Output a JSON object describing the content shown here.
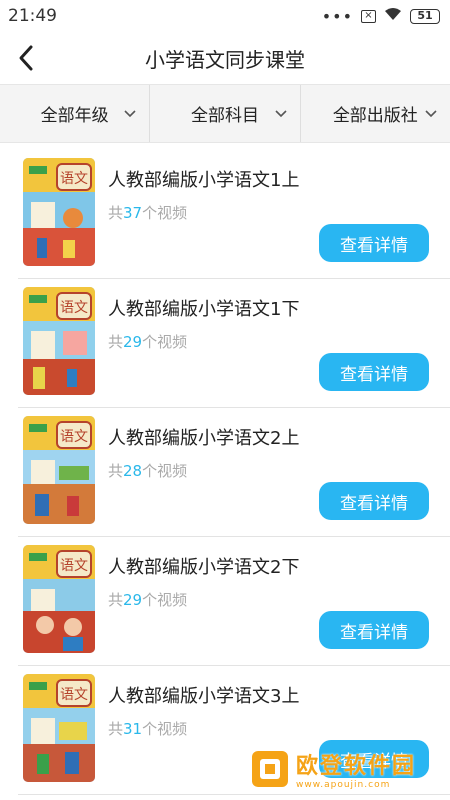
{
  "status_bar": {
    "time": "21:49",
    "dots": "•••",
    "sim": "×",
    "battery": "51"
  },
  "header": {
    "title": "小学语文同步课堂"
  },
  "filters": [
    {
      "label": "全部年级"
    },
    {
      "label": "全部科目"
    },
    {
      "label": "全部出版社"
    }
  ],
  "items": [
    {
      "title": "人教部编版小学语文1上",
      "count_prefix": "共",
      "count": "37",
      "count_suffix": "个视频",
      "button": "查看详情",
      "cover_colors": [
        "#7fc6e8",
        "#d9533a"
      ]
    },
    {
      "title": "人教部编版小学语文1下",
      "count_prefix": "共",
      "count": "29",
      "count_suffix": "个视频",
      "button": "查看详情",
      "cover_colors": [
        "#8fd0ec",
        "#c94a2e"
      ]
    },
    {
      "title": "人教部编版小学语文2上",
      "count_prefix": "共",
      "count": "28",
      "count_suffix": "个视频",
      "button": "查看详情",
      "cover_colors": [
        "#9fd4f0",
        "#d37a3a"
      ]
    },
    {
      "title": "人教部编版小学语文2下",
      "count_prefix": "共",
      "count": "29",
      "count_suffix": "个视频",
      "button": "查看详情",
      "cover_colors": [
        "#8ccbe8",
        "#c8452e"
      ]
    },
    {
      "title": "人教部编版小学语文3上",
      "count_prefix": "共",
      "count": "31",
      "count_suffix": "个视频",
      "button": "查看详情",
      "cover_colors": [
        "#94d0ec",
        "#c7583a"
      ]
    }
  ],
  "cover_label": "语文",
  "watermark": {
    "main": "欧登软件园",
    "sub": "www.apoujin.com"
  }
}
